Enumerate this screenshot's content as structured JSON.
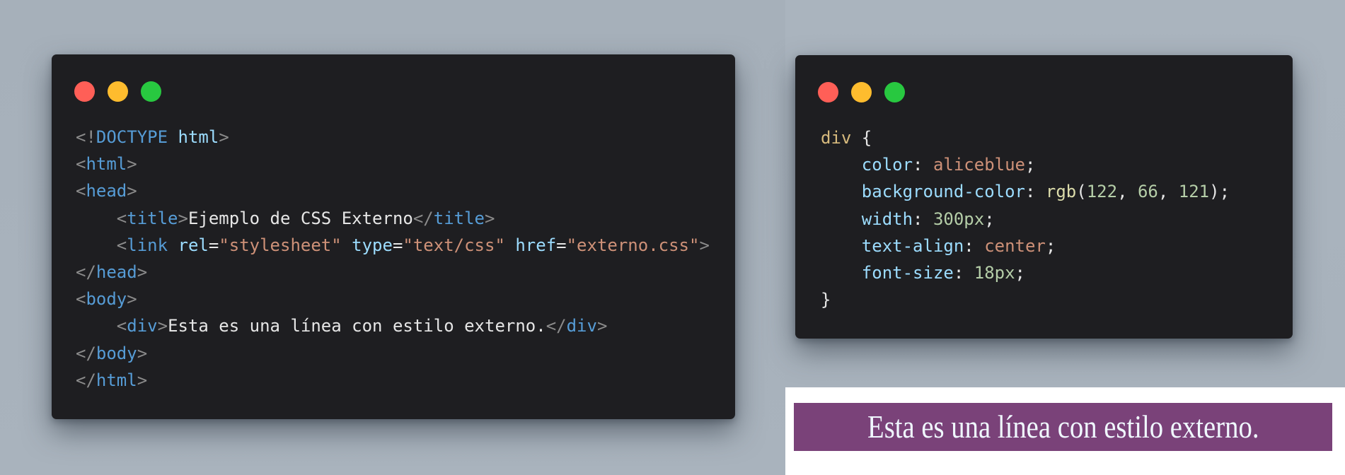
{
  "colors": {
    "background": "#a7b1bb",
    "window_bg": "#1e1e21",
    "dot_red": "#ff5f57",
    "dot_yellow": "#febc2e",
    "dot_green": "#28c840",
    "output_bar": "#7a4279",
    "output_text": "#f0f8ff"
  },
  "html_window": {
    "lines": [
      [
        "<!",
        "DOCTYPE",
        " ",
        "html",
        ">"
      ],
      [
        "<",
        "html",
        ">"
      ],
      [
        "<",
        "head",
        ">"
      ],
      [
        "    <",
        "title",
        ">",
        "Ejemplo de CSS Externo",
        "</",
        "title",
        ">"
      ],
      [
        "    <",
        "link",
        " ",
        "rel",
        "=",
        "\"stylesheet\"",
        " ",
        "type",
        "=",
        "\"text/css\"",
        " ",
        "href",
        "=",
        "\"externo.css\"",
        ">"
      ],
      [
        "</",
        "head",
        ">"
      ],
      [
        "<",
        "body",
        ">"
      ],
      [
        "    <",
        "div",
        ">",
        "Esta es una línea con estilo externo.",
        "</",
        "div",
        ">"
      ],
      [
        "</",
        "body",
        ">"
      ],
      [
        "</",
        "html",
        ">"
      ]
    ]
  },
  "css_window": {
    "lines": [
      [
        "div",
        " {"
      ],
      [
        "    ",
        "color",
        ": ",
        "aliceblue",
        ";"
      ],
      [
        "    ",
        "background-color",
        ": ",
        "rgb",
        "(",
        "122",
        ", ",
        "66",
        ", ",
        "121",
        ");"
      ],
      [
        "    ",
        "width",
        ": ",
        "300px",
        ";"
      ],
      [
        "    ",
        "text-align",
        ": ",
        "center",
        ";"
      ],
      [
        "    ",
        "font-size",
        ": ",
        "18px",
        ";"
      ],
      [
        "}"
      ]
    ]
  },
  "output": {
    "text": "Esta es una línea con estilo externo."
  }
}
